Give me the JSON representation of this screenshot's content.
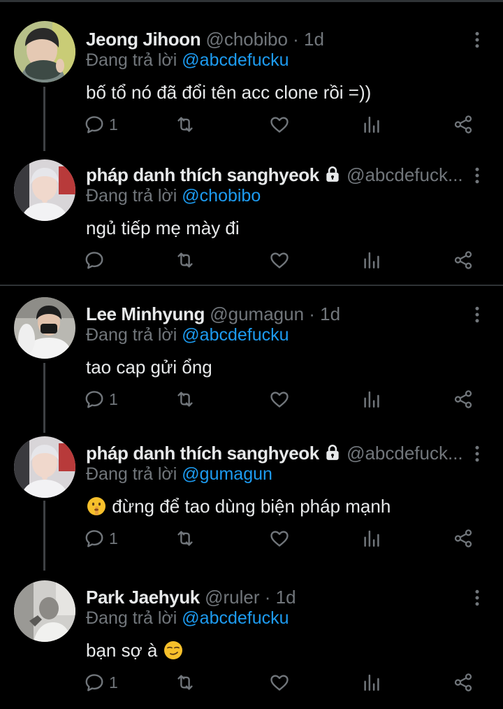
{
  "tweets": [
    {
      "name": "Jeong Jihoon",
      "handle": "@chobibo",
      "dot": " · ",
      "time": "1d",
      "reply_label": "Đang trả lời ",
      "reply_handle": "@abcdefucku",
      "text": "bố tổ nó đã đổi tên acc clone rồi =))",
      "reply_count": "1"
    },
    {
      "name": "pháp danh thích sanghyeok",
      "handle": "@abcdefuck...",
      "reply_label": "Đang trả lời ",
      "reply_handle": "@chobibo",
      "text": "ngủ tiếp mẹ mày đi",
      "reply_count": ""
    },
    {
      "name": "Lee Minhyung",
      "handle": "@gumagun",
      "dot": " · ",
      "time": "1d",
      "reply_label": "Đang trả lời ",
      "reply_handle": "@abcdefucku",
      "text": "tao cap gửi ổng",
      "reply_count": "1"
    },
    {
      "name": "pháp danh thích sanghyeok",
      "handle": "@abcdefuck...",
      "reply_label": "Đang trả lời ",
      "reply_handle": "@gumagun",
      "text": "đừng để tao dùng biện pháp mạnh",
      "reply_count": "1"
    },
    {
      "name": "Park Jaehyuk",
      "handle": "@ruler",
      "dot": " · ",
      "time": "1d",
      "reply_label": "Đang trả lời ",
      "reply_handle": "@abcdefucku",
      "text": "bạn sợ à",
      "reply_count": "1"
    }
  ],
  "icons": {
    "reply": "reply-icon",
    "retweet": "retweet-icon",
    "like": "like-icon",
    "views": "views-icon",
    "share": "share-icon",
    "more": "more-icon",
    "lock": "lock-icon",
    "emoji_shush": "shushing-face-emoji",
    "emoji_smirk": "smirking-face-emoji"
  },
  "colors": {
    "background": "#000000",
    "text": "#e7e9ea",
    "muted": "#71767b",
    "link": "#1d9bf0",
    "divider": "#2f3336"
  }
}
